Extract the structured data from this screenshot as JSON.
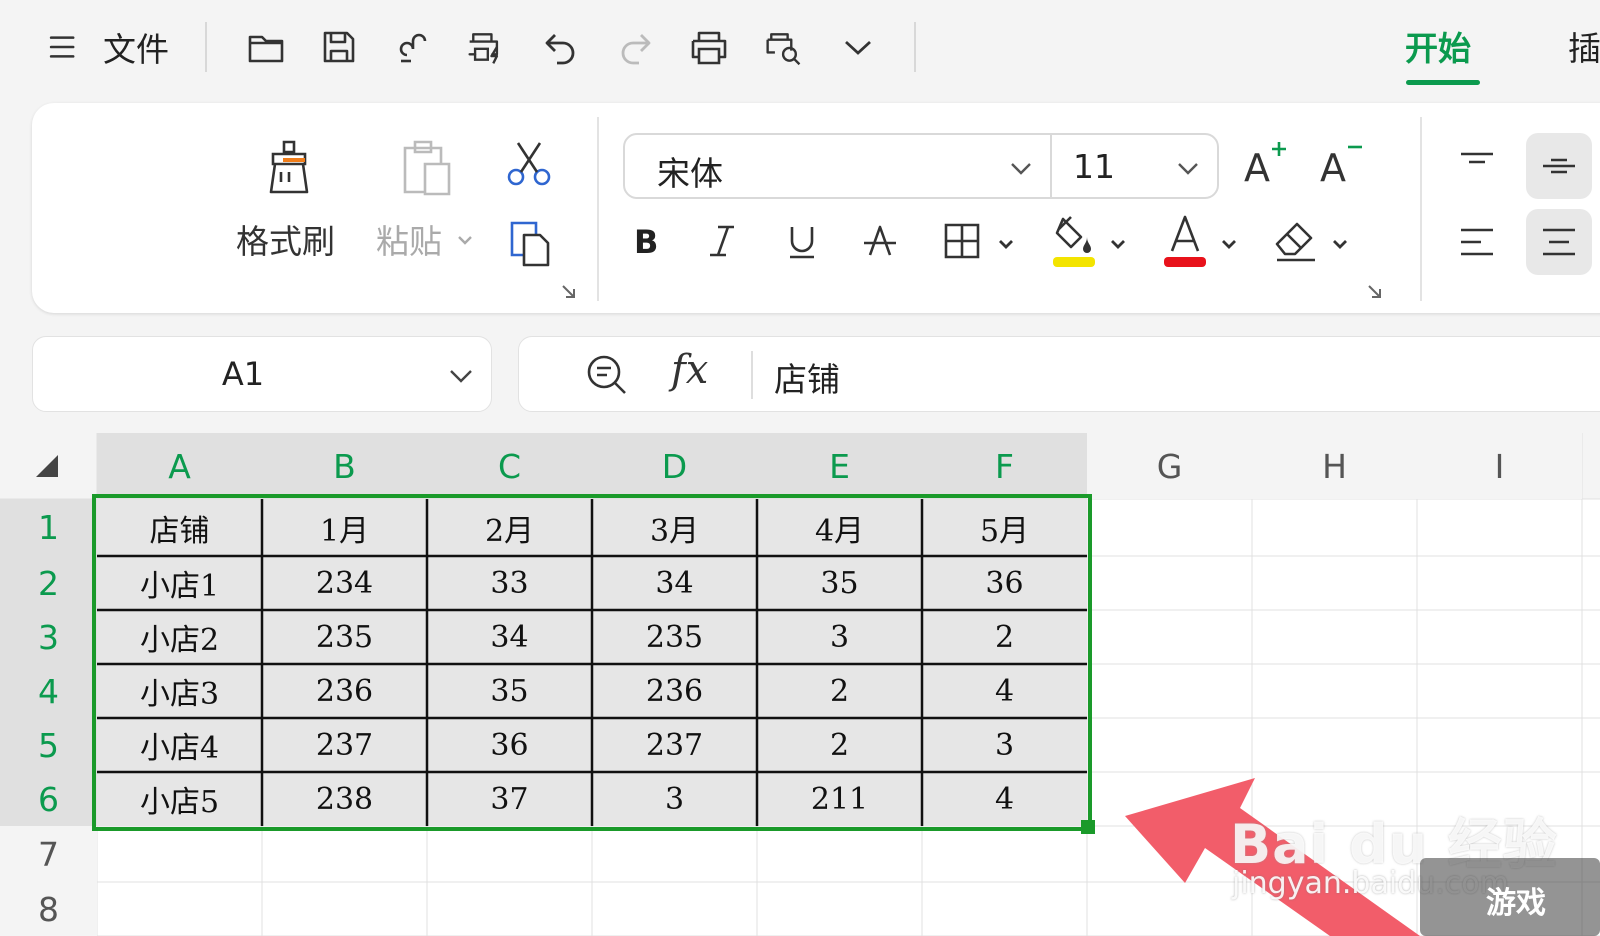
{
  "topbar": {
    "file_label": "文件",
    "tab_start": "开始",
    "tab_insert": "插"
  },
  "ribbon": {
    "format_painter_label": "格式刷",
    "paste_label": "粘贴",
    "font_name": "宋体",
    "font_size": "11",
    "colors": {
      "highlight": "#f3e400",
      "font_color": "#e8121b",
      "accent": "#0b9a4e"
    }
  },
  "formula_bar": {
    "name_box": "A1",
    "fx_label": "fx",
    "value": "店铺"
  },
  "sheet": {
    "columns": [
      "A",
      "B",
      "C",
      "D",
      "E",
      "F",
      "G",
      "H",
      "I"
    ],
    "rows": [
      "1",
      "2",
      "3",
      "4",
      "5",
      "6",
      "7",
      "8"
    ],
    "data": [
      [
        "店铺",
        "1月",
        "2月",
        "3月",
        "4月",
        "5月"
      ],
      [
        "小店1",
        "234",
        "33",
        "34",
        "35",
        "36"
      ],
      [
        "小店2",
        "235",
        "34",
        "235",
        "3",
        "2"
      ],
      [
        "小店3",
        "236",
        "35",
        "236",
        "2",
        "4"
      ],
      [
        "小店4",
        "237",
        "36",
        "237",
        "2",
        "3"
      ],
      [
        "小店5",
        "238",
        "37",
        "3",
        "211",
        "4"
      ]
    ]
  },
  "watermark": {
    "brand": "Bai du 经验",
    "url": "jingyan.baidu.com",
    "logo_text": "游戏"
  }
}
